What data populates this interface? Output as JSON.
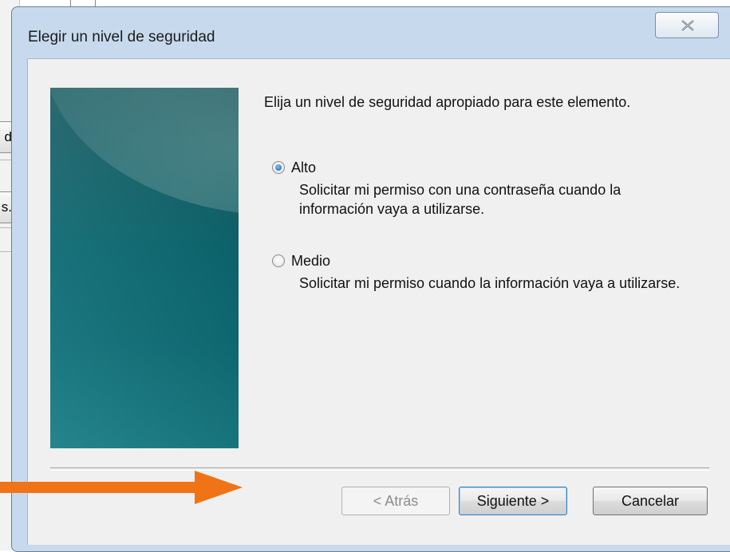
{
  "background_window": {
    "button_1_fragment": "d",
    "button_2_fragment": "s."
  },
  "dialog": {
    "title": "Elegir un nivel de seguridad",
    "close_icon": "close-x-icon",
    "instruction": "Elija un nivel de seguridad apropiado para este elemento.",
    "options": [
      {
        "label": "Alto",
        "description": "Solicitar mi permiso con una contraseña cuando la información vaya a utilizarse.",
        "selected": true
      },
      {
        "label": "Medio",
        "description": "Solicitar mi permiso cuando la información vaya a utilizarse.",
        "selected": false
      }
    ],
    "buttons": {
      "back": "< Atrás",
      "next": "Siguiente >",
      "cancel": "Cancelar"
    }
  },
  "annotation": {
    "arrow_color": "#f07316"
  }
}
